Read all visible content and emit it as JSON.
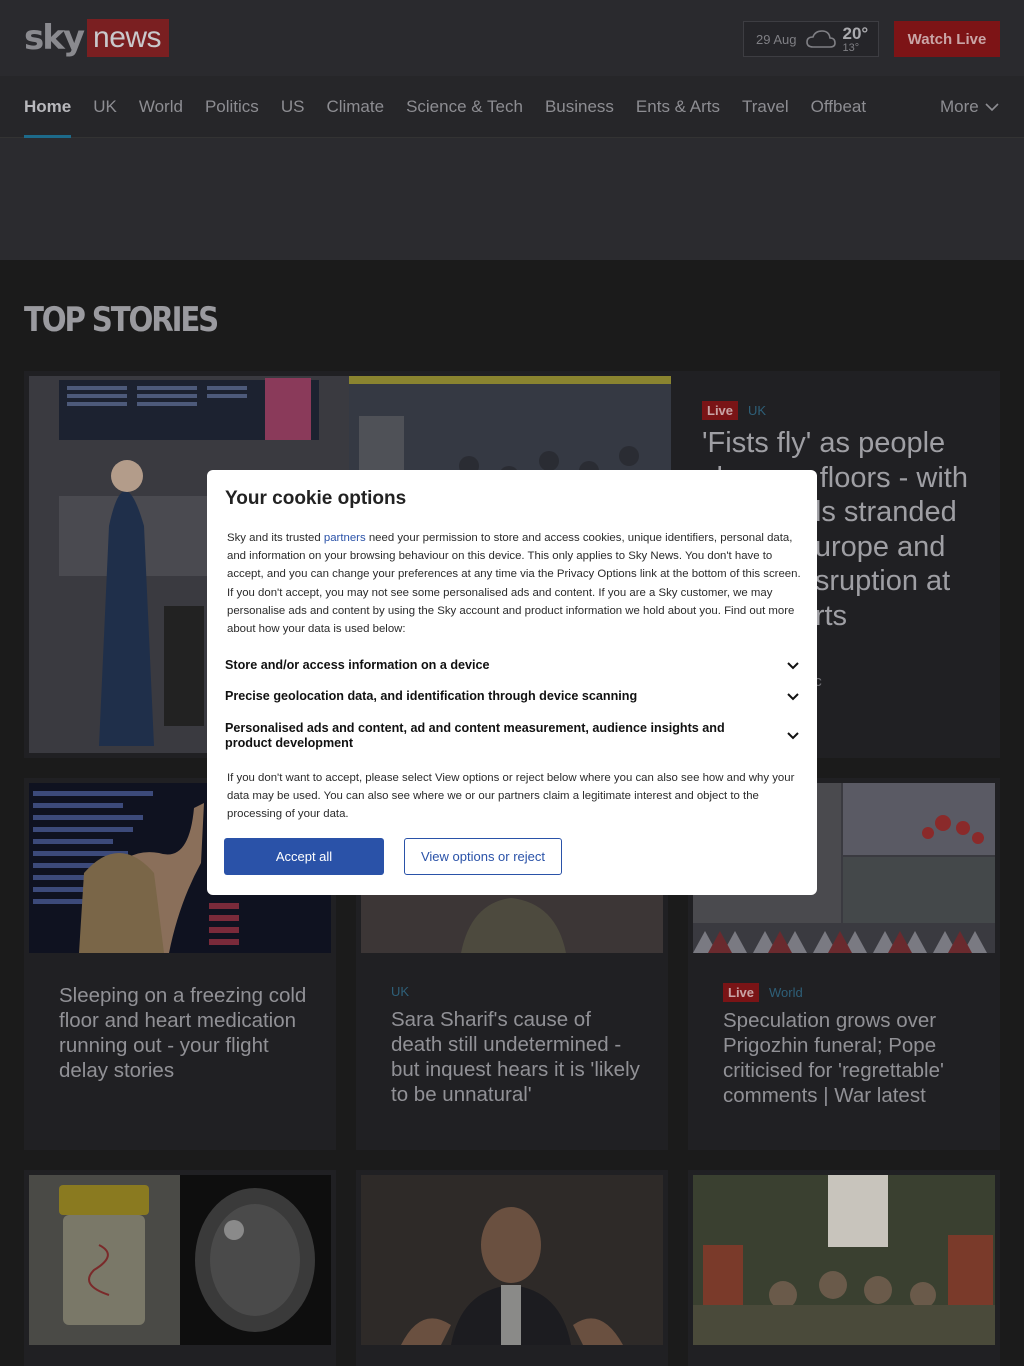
{
  "header": {
    "logo_sky": "sky",
    "logo_news": "news",
    "weather": {
      "date": "29 Aug",
      "high": "20°",
      "low": "13°",
      "icon": "cloud-icon"
    },
    "watch_live": "Watch Live"
  },
  "nav": {
    "items": [
      "Home",
      "UK",
      "World",
      "Politics",
      "US",
      "Climate",
      "Science & Tech",
      "Business",
      "Ents & Arts",
      "Travel",
      "Offbeat"
    ],
    "more": "More"
  },
  "section_title": "TOP STORIES",
  "hero": {
    "badge": "Live",
    "category": "UK",
    "headline": "'Fists fly' as people sleep on floors - with thousands stranded across Europe and Britain disruption at UK airports",
    "subtext": "...out UK air traffic"
  },
  "stories": [
    {
      "category": "",
      "badge": "",
      "headline": "Sleeping on a freezing cold floor and heart medication running out - your flight delay stories"
    },
    {
      "category": "UK",
      "badge": "",
      "headline": "Sara Sharif's cause of death still undetermined - but inquest hears it is 'likely to be unnatural'"
    },
    {
      "category": "World",
      "badge": "Live",
      "headline": "Speculation grows over Prigozhin funeral; Pope criticised for 'regrettable' comments | War latest"
    }
  ],
  "cookie_modal": {
    "title": "Your cookie options",
    "body_pre": "Sky and its trusted ",
    "body_link": "partners",
    "body_post": " need your permission to store and access cookies, unique identifiers, personal data, and information on your browsing behaviour on this device. This only applies to Sky News. You don't have to accept, and you can change your preferences at any time via the Privacy Options link at the bottom of this screen. If you don't accept, you may not see some personalised ads and content.  If you are a Sky customer, we may personalise ads and content by using the Sky account and product information we hold about you. Find out more about how your data is used below:",
    "purposes": [
      "Store and/or access information on a device",
      "Precise geolocation data, and identification through device scanning",
      "Personalised ads and content, ad and content measurement, audience insights and product development"
    ],
    "footer": "If you don't want to accept, please select View options or reject below where you can also see how and why your data may be used. You can also see where we or our partners claim a legitimate interest and object to the processing of your data.",
    "accept": "Accept all",
    "view": "View options or reject"
  },
  "colors": {
    "brand_red": "#c4161c",
    "accent_blue": "#2a52a8",
    "active_underline": "#1d6a8a"
  }
}
